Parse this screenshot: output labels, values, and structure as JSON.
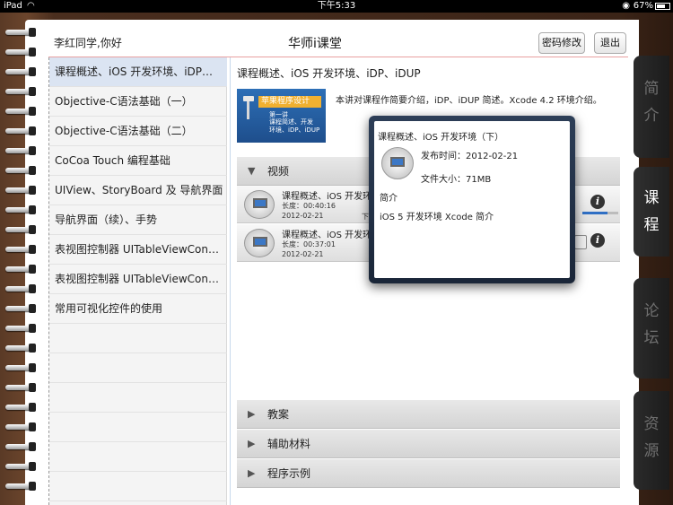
{
  "status_bar": {
    "device": "iPad",
    "time": "下午5:33",
    "battery": "67%",
    "battery_level": 0.67
  },
  "header": {
    "greeting": "李红同学,你好",
    "title": "华师i课堂",
    "change_password": "密码修改",
    "logout": "退出"
  },
  "lessons": [
    "课程概述、iOS 开发环境、iDP…",
    "Objective-C语法基础（一）",
    "Objective-C语法基础（二）",
    "CoCoa Touch 编程基础",
    "UIView、StoryBoard 及 导航界面",
    "导航界面（续）、手势",
    "表视图控制器 UITableViewCon…",
    "表视图控制器 UITableViewCon…",
    "常用可视化控件的使用"
  ],
  "detail": {
    "title": "课程概述、iOS 开发环境、iDP、iDUP",
    "thumb_banner": "苹果程序设计",
    "thumb_line1": "第一讲",
    "thumb_line2": "课程简述、开发",
    "thumb_line3": "环境、iDP、iDUP",
    "description": "本讲对课程作简要介绍，iDP、iDUP 简述。Xcode 4.2 环境介绍。",
    "video_section": "视频",
    "videos": [
      {
        "title": "课程概述、iOS 开发环",
        "duration": "长度：00:40:16",
        "date": "2012-02-21",
        "download": "下"
      },
      {
        "title": "课程概述、iOS 开发环",
        "duration": "长度：00:37:01",
        "date": "2012-02-21"
      }
    ],
    "download_progress": 0.7,
    "sections": [
      "教案",
      "辅助材料",
      "程序示例"
    ]
  },
  "popover": {
    "title": "课程概述、iOS 开发环境（下）",
    "date": "发布时间：2012-02-21",
    "size": "文件大小：71MB",
    "intro_label": "简介",
    "intro": "iOS 5 开发环境 Xcode 简介"
  },
  "tabs": [
    {
      "line1": "简",
      "line2": "介"
    },
    {
      "line1": "课",
      "line2": "程"
    },
    {
      "line1": "论",
      "line2": "坛"
    },
    {
      "line1": "资",
      "line2": "源"
    }
  ],
  "colors": {
    "active_lesson": "#dbe4f2",
    "leather": "#4a2e1e",
    "accent_blue": "#2f6fc4"
  }
}
